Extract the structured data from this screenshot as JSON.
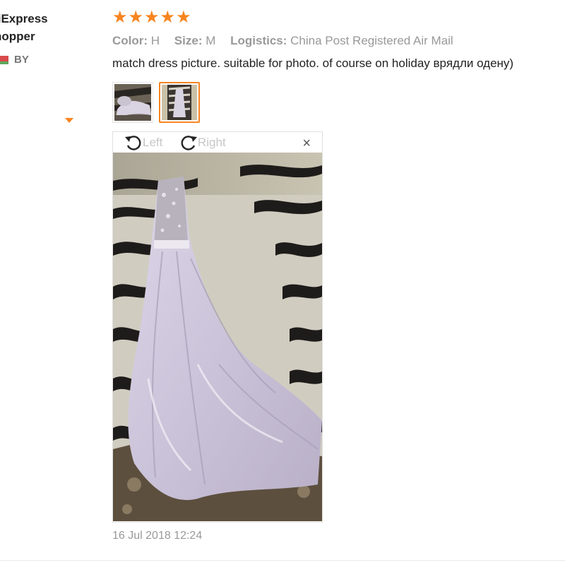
{
  "user": {
    "name": "liExpress\nhopper",
    "country_code": "BY"
  },
  "review": {
    "stars": "★★★★★",
    "rating": 5,
    "color_label": "Color:",
    "color_value": "H",
    "size_label": "Size:",
    "size_value": "M",
    "logistics_label": "Logistics:",
    "logistics_value": "China Post Registered Air Mail",
    "comment": "match dress picture. suitable for photo. of course on holiday врядли одену)",
    "date": "16 Jul 2018 12:24"
  },
  "viewer": {
    "rotate_left_label": "Left",
    "rotate_right_label": "Right",
    "close_label": "×",
    "active_thumbnail_index": 2
  },
  "colors": {
    "accent": "#f7841f",
    "muted_text": "#999999",
    "body_text": "#222222"
  }
}
